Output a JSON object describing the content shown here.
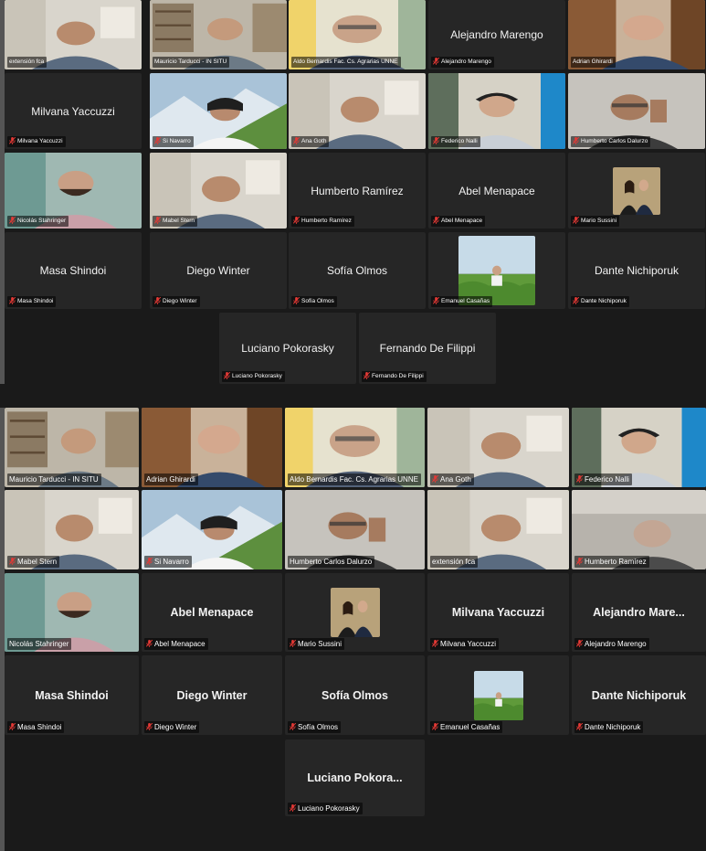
{
  "panel_top": {
    "tiles": [
      {
        "name": "extensión fca",
        "type": "video",
        "scene": "room-white",
        "muted": false
      },
      {
        "name": "Mauricio Tarducci - IN SITU",
        "type": "video",
        "scene": "room-shelf",
        "muted": false
      },
      {
        "name": "Aldo Bernardis Fac. Cs. Agrarias UNNE",
        "type": "video",
        "scene": "room-curtain",
        "muted": false
      },
      {
        "name": "Alejandro Marengo",
        "type": "name",
        "muted": true
      },
      {
        "name": "Adrian Ghirardi",
        "type": "video",
        "scene": "room-wood",
        "muted": false
      },
      {
        "name": "Milvana Yaccuzzi",
        "type": "name",
        "muted": true
      },
      {
        "name": "Si Navarro",
        "type": "video",
        "scene": "mountain",
        "muted": true
      },
      {
        "name": "Ana Goth",
        "type": "video",
        "scene": "room-white",
        "muted": true
      },
      {
        "name": "Federico Nalli",
        "type": "video",
        "scene": "room-blue",
        "muted": true
      },
      {
        "name": "Humberto  Carlos Dalurzo",
        "type": "video",
        "scene": "room-gray",
        "muted": true
      },
      {
        "name": "Nicolás Stahringer",
        "type": "video",
        "scene": "room-teal",
        "muted": true
      },
      {
        "name": "Mabel Stern",
        "type": "video",
        "scene": "room-white",
        "muted": true
      },
      {
        "name": "Humberto Ramírez",
        "type": "name",
        "muted": true
      },
      {
        "name": "Abel Menapace",
        "type": "name",
        "muted": true
      },
      {
        "name": "Mario Sussini",
        "type": "avatar",
        "scene": "couple",
        "muted": true
      },
      {
        "name": "Masa Shindoi",
        "type": "name",
        "muted": true
      },
      {
        "name": "Diego Winter",
        "type": "name",
        "muted": true
      },
      {
        "name": "Sofía Olmos",
        "type": "name",
        "muted": true
      },
      {
        "name": "Emanuel Casañas",
        "type": "avatar-large",
        "scene": "field",
        "muted": true
      },
      {
        "name": "Dante Nichiporuk",
        "type": "name",
        "muted": true
      },
      {
        "name": "Luciano Pokorasky",
        "type": "name",
        "muted": true
      },
      {
        "name": "Fernando De Filippi",
        "type": "name",
        "muted": true
      }
    ]
  },
  "panel_bottom": {
    "tiles": [
      {
        "name": "Mauricio Tarducci - IN SITU",
        "label": "Mauricio Tarducci - IN SITU",
        "type": "video",
        "scene": "room-shelf",
        "muted": false
      },
      {
        "name": "Adrian Ghirardi",
        "label": "Adrian Ghirardi",
        "type": "video",
        "scene": "room-wood",
        "muted": false
      },
      {
        "name": "Aldo Bernardis Fac. Cs. Agrarias UNNE",
        "label": "Aldo Bernardis Fac. Cs. Agrarias UNNE",
        "type": "video",
        "scene": "room-curtain",
        "muted": false
      },
      {
        "name": "Ana Goth",
        "label": "Ana Goth",
        "type": "video",
        "scene": "room-white",
        "muted": true
      },
      {
        "name": "Federico Nalli",
        "label": "Federico Nalli",
        "type": "video",
        "scene": "room-blue",
        "muted": true
      },
      {
        "name": "Mabel Stern",
        "label": "Mabel Stern",
        "type": "video",
        "scene": "room-white",
        "muted": true
      },
      {
        "name": "Si Navarro",
        "label": "Si Navarro",
        "type": "video",
        "scene": "mountain",
        "muted": true
      },
      {
        "name": "Humberto  Carlos Dalurzo",
        "label": "Humberto  Carlos Dalurzo",
        "type": "video",
        "scene": "room-gray",
        "muted": false
      },
      {
        "name": "extensión fca",
        "label": "extensión fca",
        "type": "video",
        "scene": "room-white",
        "muted": false,
        "active": true
      },
      {
        "name": "Humberto Ramírez",
        "label": "Humberto Ramírez",
        "type": "video",
        "scene": "room-dim",
        "muted": true
      },
      {
        "name": "Nicolás Stahringer",
        "label": "Nicolás Stahringer",
        "type": "video",
        "scene": "room-teal",
        "muted": false
      },
      {
        "name": "Abel Menapace",
        "label": "Abel Menapace",
        "type": "name",
        "muted": true
      },
      {
        "name": "Mario Sussini",
        "label": "Mario Sussini",
        "type": "avatar",
        "scene": "couple",
        "muted": true
      },
      {
        "name": "Milvana Yaccuzzi",
        "label": "Milvana Yaccuzzi",
        "type": "name",
        "muted": true
      },
      {
        "name": "Alejandro  Mare...",
        "label": "Alejandro Marengo",
        "type": "name",
        "muted": true
      },
      {
        "name": "Masa Shindoi",
        "label": "Masa Shindoi",
        "type": "name",
        "muted": true
      },
      {
        "name": "Diego Winter",
        "label": "Diego Winter",
        "type": "name",
        "muted": true
      },
      {
        "name": "Sofía Olmos",
        "label": "Sofía Olmos",
        "type": "name",
        "muted": true
      },
      {
        "name": "Emanuel Casañas",
        "label": "Emanuel Casañas",
        "type": "avatar",
        "scene": "field",
        "muted": true
      },
      {
        "name": "Dante Nichiporuk",
        "label": "Dante Nichiporuk",
        "type": "name",
        "muted": true
      },
      {
        "name": "Luciano  Pokora...",
        "label": "Luciano Pokorasky",
        "type": "name",
        "muted": true
      }
    ]
  },
  "icons": {
    "mic_muted": "mic-muted-icon",
    "mic_muted_color": "#e53935"
  },
  "colors": {
    "background": "#1a1a1a",
    "tile": "#262626",
    "active_speaker": "#b9d95a"
  }
}
